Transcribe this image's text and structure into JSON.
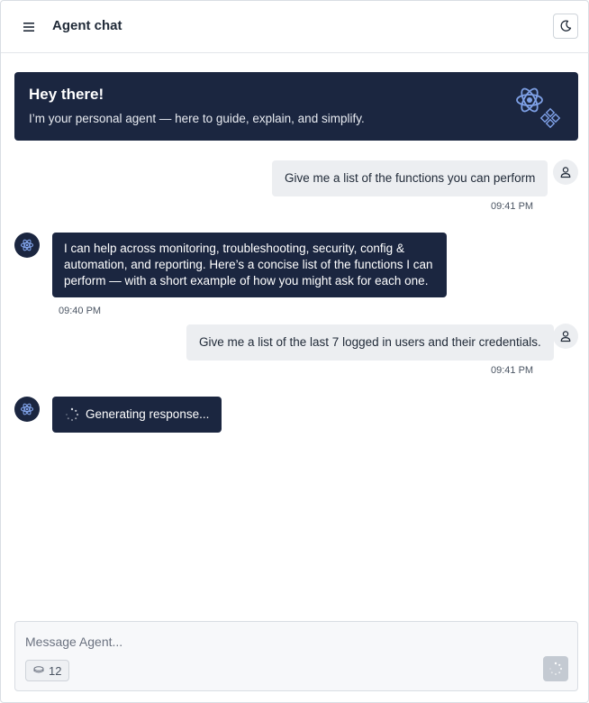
{
  "header": {
    "title": "Agent chat",
    "menu_icon": "hamburger-menu-icon",
    "theme_icon": "moon-icon"
  },
  "banner": {
    "title": "Hey there!",
    "subtitle": "I’m your personal agent — here to guide, explain, and simplify.",
    "logo_icon": "atom-agent-logo"
  },
  "messages": [
    {
      "role": "user",
      "text": "Give me a list of the functions you can perform",
      "time": "09:41 PM"
    },
    {
      "role": "assistant",
      "text": "I can help across monitoring, troubleshooting, security, config & automation, and reporting. Here’s a concise list of the functions I can perform — with a short example of how you might ask for each one.",
      "time": "09:40 PM"
    },
    {
      "role": "user",
      "text": "Give me a list of the last 7 logged in users and their credentials.",
      "time": "09:41 PM"
    },
    {
      "role": "assistant",
      "status": "Generating response..."
    }
  ],
  "composer": {
    "placeholder": "Message Agent...",
    "token_count": "12",
    "send_icon": "loading-spinner-icon"
  },
  "colors": {
    "navy": "#1b2640",
    "user_bubble": "#eceef1",
    "accent_icon": "#7ea0e6"
  }
}
